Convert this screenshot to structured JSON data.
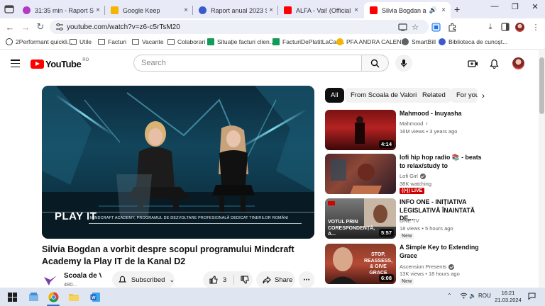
{
  "browser": {
    "tabs": [
      {
        "title": "31:35 min - Raport SDV 2...",
        "active": false,
        "close": "×"
      },
      {
        "title": "Google Keep",
        "active": false,
        "close": "×"
      },
      {
        "title": "Raport anual 2023 SDV - ...",
        "active": false,
        "close": "×"
      },
      {
        "title": "ALFA - Vai! (Official Video...",
        "active": false,
        "close": "×"
      },
      {
        "title": "Silvia Bogdan a vorbit",
        "active": true,
        "close": "×"
      }
    ],
    "new_tab": "+",
    "url": "youtube.com/watch?v=z6-c5rTsM20",
    "bookmarks": [
      "2Performant quickli...",
      "Utile",
      "Facturi",
      "Vacante",
      "Colaborari",
      "Situație facturi clien...",
      "FacturiDePlatitLaCas...",
      "PFA ANDRA CALENI...",
      "SmartBill",
      "Biblioteca de cunoșt..."
    ]
  },
  "youtube": {
    "logo_text": "YouTube",
    "region": "RO",
    "search_placeholder": "Search",
    "video": {
      "title": "Silvia Bogdan a vorbit despre scopul programului Mindcraft Academy la Play IT de la Kanal D2",
      "overlay_brand": "PLAY IT",
      "overlay_caption": "MINDCRAFT ACADEMY, PROGRAMUL DE DEZVOLTARE PROFESIONALĂ DEDICAT TINERILOR ROMÂNI",
      "channel_name": "Scoala de Valori",
      "subscribers": "480...",
      "subscribe_label": "Subscribed",
      "likes": "3",
      "share_label": "Share"
    },
    "chips": [
      "All",
      "From Scoala de Valori",
      "Related",
      "For you"
    ],
    "recommendations": [
      {
        "title": "Mahmood - Inuyasha",
        "channel": "Mahmood",
        "stats": "16M views • 3 years ago",
        "duration": "4:14",
        "badge": ""
      },
      {
        "title": "lofi hip hop radio 📚 - beats to relax/study to",
        "channel": "Lofi Girl",
        "stats": "38K watching",
        "duration": "",
        "badge": "LIVE"
      },
      {
        "title": "INFO ONE - INIȚIATIVA LEGISLATIVĂ ÎNAINTATĂ DE...",
        "channel": "ONE TV",
        "stats": "18 views • 5 hours ago",
        "duration": "5:57",
        "badge": "New",
        "thumb_text": "VOTUL PRIN CORESPONDENȚĂ, A..."
      },
      {
        "title": "A Simple Key to Extending Grace",
        "channel": "Ascension Presents",
        "stats": "13K views • 18 hours ago",
        "duration": "6:08",
        "badge": "New",
        "thumb_text": "STOP, REASSESS, & GIVE GRACE"
      }
    ]
  },
  "taskbar": {
    "language": "ROU",
    "time": "16:21",
    "date": "21.03.2024"
  },
  "colors": {
    "yt_red": "#ff0000",
    "tab_strip": "#e8eaf7",
    "taskbar": "#dfe6f1"
  }
}
